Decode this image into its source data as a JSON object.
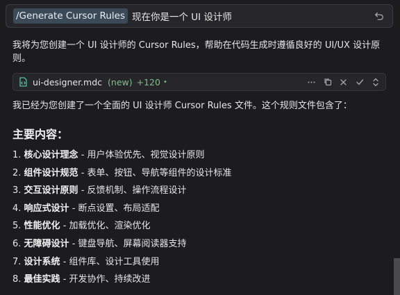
{
  "prompt": {
    "command": "/Generate Cursor Rules",
    "text": "现在你是一个 UI 设计师"
  },
  "intro": "我将为您创建一个 UI 设计师的 Cursor Rules，帮助在代码生成时遵循良好的 UI/UX 设计原则。",
  "file": {
    "name": "ui-designer.mdc",
    "status": "(new)",
    "added": "+120",
    "dot": "•"
  },
  "summary": "我已经为您创建了一个全面的 UI 设计师 Cursor Rules 文件。这个规则文件包含了：",
  "heading": "主要内容：",
  "items": [
    {
      "num": "1.",
      "term": "核心设计理念",
      "desc": " - 用户体验优先、视觉设计原则"
    },
    {
      "num": "2.",
      "term": "组件设计规范",
      "desc": " - 表单、按钮、导航等组件的设计标准"
    },
    {
      "num": "3.",
      "term": "交互设计原则",
      "desc": " - 反馈机制、操作流程设计"
    },
    {
      "num": "4.",
      "term": "响应式设计",
      "desc": " - 断点设置、布局适配"
    },
    {
      "num": "5.",
      "term": "性能优化",
      "desc": " - 加载优化、渲染优化"
    },
    {
      "num": "6.",
      "term": "无障碍设计",
      "desc": " - 键盘导航、屏幕阅读器支持"
    },
    {
      "num": "7.",
      "term": "设计系统",
      "desc": " - 组件库、设计工具使用"
    },
    {
      "num": "8.",
      "term": "最佳实践",
      "desc": " - 开发协作、持续改进"
    }
  ],
  "colors": {
    "background": "#1c1c1f",
    "chip": "#3b4a57",
    "added_green": "#7cc08a",
    "file_icon": "#4fc1a6"
  },
  "icons": [
    "undo-icon",
    "file-code-icon",
    "more-icon",
    "copy-icon",
    "close-icon",
    "check-icon",
    "expand-icon"
  ]
}
